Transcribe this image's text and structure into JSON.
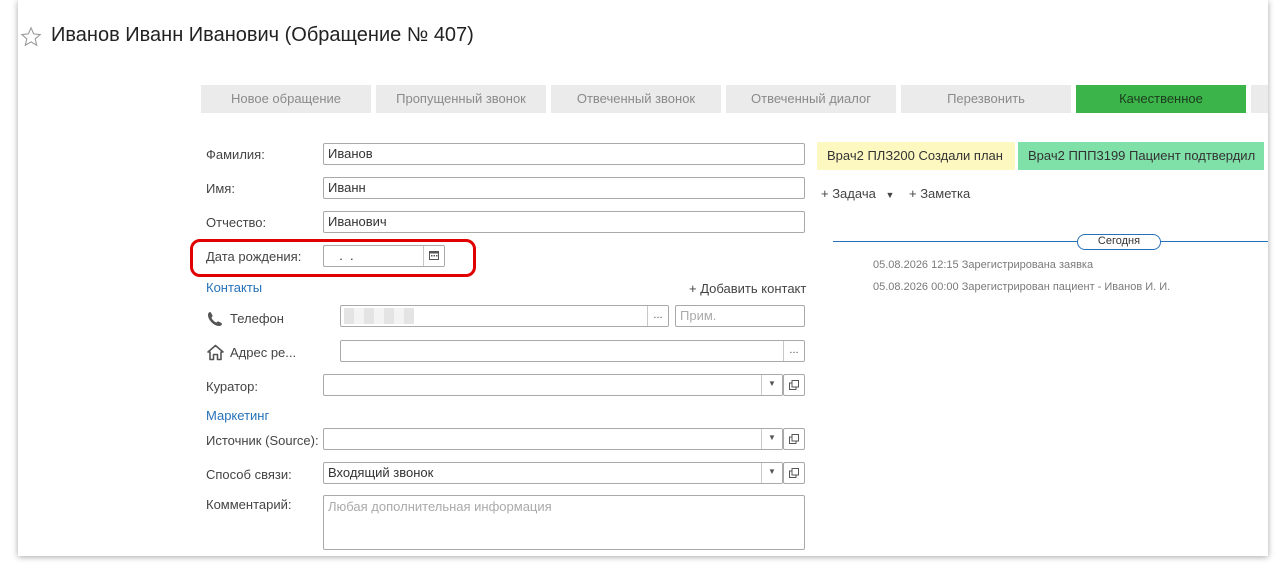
{
  "header": {
    "title": "Иванов Иванн Иванович (Обращение № 407)"
  },
  "tabs": [
    {
      "label": "Новое обращение"
    },
    {
      "label": "Пропущенный звонок"
    },
    {
      "label": "Отвеченный звонок"
    },
    {
      "label": "Отвеченный диалог"
    },
    {
      "label": "Перезвонить"
    },
    {
      "label": "Качественное"
    }
  ],
  "form": {
    "lastname": {
      "label": "Фамилия:",
      "value": "Иванов"
    },
    "firstname": {
      "label": "Имя:",
      "value": "Иванн"
    },
    "patronymic": {
      "label": "Отчество:",
      "value": "Иванович"
    },
    "birthdate": {
      "label": "Дата рождения:",
      "value": "  .  ."
    },
    "contacts_section": "Контакты",
    "add_contact": "+ Добавить контакт",
    "phone": {
      "label": "Телефон",
      "value": "",
      "note_placeholder": "Прим."
    },
    "address": {
      "label": "Адрес ре...",
      "value": ""
    },
    "curator": {
      "label": "Куратор:",
      "value": ""
    },
    "marketing_section": "Маркетинг",
    "source": {
      "label": "Источник (Source):",
      "value": ""
    },
    "contact_method": {
      "label": "Способ связи:",
      "value": "Входящий звонок"
    },
    "comment": {
      "label": "Комментарий:",
      "placeholder": "Любая дополнительная информация"
    }
  },
  "statuses": [
    {
      "text": "Врач2 ПЛЗ200  Создали план",
      "color": "#fdf8c0"
    },
    {
      "text": "Врач2 ППП3199  Пациент подтвердил",
      "color": "#7fe0a8"
    }
  ],
  "actions": {
    "task": "+ Задача",
    "note": "+ Заметка"
  },
  "timeline": {
    "today_label": "Сегодня",
    "events": [
      "05.08.2026 12:15 Зарегистрирована заявка",
      "05.08.2026 00:00 Зарегистрирован пациент - Иванов И. И."
    ]
  }
}
